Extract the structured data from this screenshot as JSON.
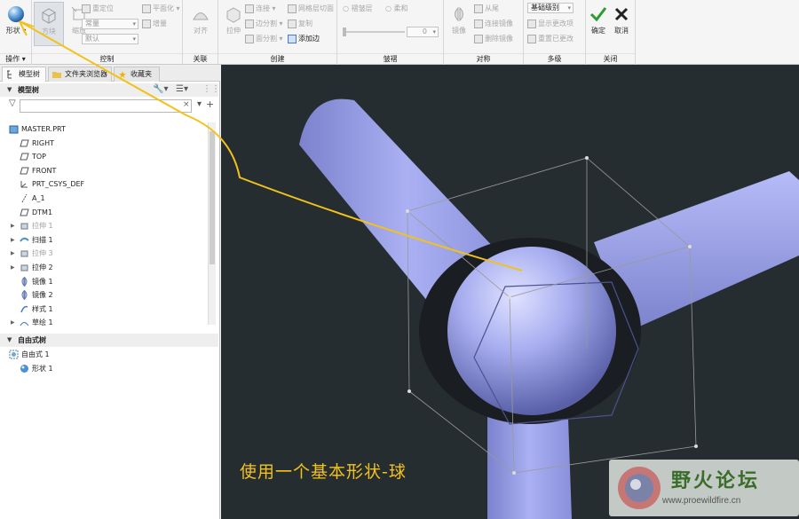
{
  "ribbon": {
    "operations": {
      "big": "形状",
      "label": "操作"
    },
    "control": {
      "box_btn": "方块",
      "scale_btn": "缩放",
      "reposition": "重定位",
      "flatten": "平面化",
      "combo1": "常量",
      "combo2": "默认",
      "increase": "增量",
      "label": "控制"
    },
    "associate": {
      "align": "对齐",
      "label": "关联"
    },
    "create": {
      "extrude": "拉伸",
      "connect": "连接",
      "edge_split": "边分割",
      "face_split": "面分割",
      "mesh_cut": "网格层切面",
      "copy": "复制",
      "add_edge": "添加边",
      "label": "创建"
    },
    "crease": {
      "transition": "褶皱层",
      "soft": "柔和",
      "value": "0",
      "label": "皱褶"
    },
    "symmetry": {
      "mirror": "镜像",
      "from_tail": "从尾",
      "connect_mirror": "连接镜像",
      "delete_mirror": "删除镜像",
      "label": "对称"
    },
    "multilevel": {
      "combo": "基础级别",
      "show_changes": "显示更改项",
      "reset_changes": "重置已更改",
      "label": "多级"
    },
    "close": {
      "confirm": "确定",
      "cancel": "取消",
      "label": "关闭"
    }
  },
  "tabs": [
    {
      "label": "模型树"
    },
    {
      "label": "文件夹浏览器"
    },
    {
      "label": "收藏夹"
    }
  ],
  "model_tree": {
    "header": "模型树",
    "items": [
      {
        "label": "MASTER.PRT",
        "icon": "part-icon"
      },
      {
        "label": "RIGHT",
        "icon": "datum-plane-icon"
      },
      {
        "label": "TOP",
        "icon": "datum-plane-icon"
      },
      {
        "label": "FRONT",
        "icon": "datum-plane-icon"
      },
      {
        "label": "PRT_CSYS_DEF",
        "icon": "csys-icon"
      },
      {
        "label": "A_1",
        "icon": "axis-icon"
      },
      {
        "label": "DTM1",
        "icon": "datum-plane-icon"
      },
      {
        "label": "拉伸 1",
        "icon": "extrude-icon"
      },
      {
        "label": "扫描 1",
        "icon": "sweep-icon"
      },
      {
        "label": "拉伸 3",
        "icon": "extrude-icon"
      },
      {
        "label": "拉伸 2",
        "icon": "extrude-icon"
      },
      {
        "label": "镜像 1",
        "icon": "mirror-icon"
      },
      {
        "label": "镜像 2",
        "icon": "mirror-icon"
      },
      {
        "label": "样式 1",
        "icon": "style-icon"
      },
      {
        "label": "草绘 1",
        "icon": "sketch-icon"
      }
    ]
  },
  "freestyle_tree": {
    "header": "自由式树",
    "items": [
      {
        "label": "自由式 1"
      },
      {
        "label": "形状 1"
      }
    ]
  },
  "caption": "使用一个基本形状-球",
  "watermark": {
    "title": "野火论坛",
    "url": "www.proewildfire.cn"
  },
  "colors": {
    "viewport_bg": "#262d31",
    "model": "#9da3ec",
    "caption": "#f2c21b"
  }
}
